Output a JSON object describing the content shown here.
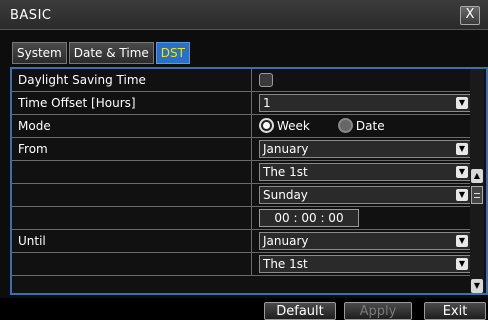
{
  "window": {
    "title": "BASIC",
    "close_label": "X"
  },
  "tabs": [
    {
      "label": "System",
      "active": false
    },
    {
      "label": "Date & Time",
      "active": false
    },
    {
      "label": "DST",
      "active": true
    }
  ],
  "rows": {
    "dst_label": "Daylight Saving Time",
    "dst_checked": false,
    "offset_label": "Time Offset [Hours]",
    "offset_value": "1",
    "mode_label": "Mode",
    "mode_week": "Week",
    "mode_date": "Date",
    "from_label": "From",
    "from_month": "January",
    "from_week": "The 1st",
    "from_day": "Sunday",
    "from_time": "00 : 00 : 00",
    "until_label": "Until",
    "until_month": "January",
    "until_week": "The 1st"
  },
  "buttons": {
    "default": "Default",
    "apply": "Apply",
    "exit": "Exit"
  },
  "colors": {
    "active_tab_bg": "#2a6fc9",
    "active_tab_text": "#f2e400",
    "grid_border": "#3b6fb2"
  }
}
